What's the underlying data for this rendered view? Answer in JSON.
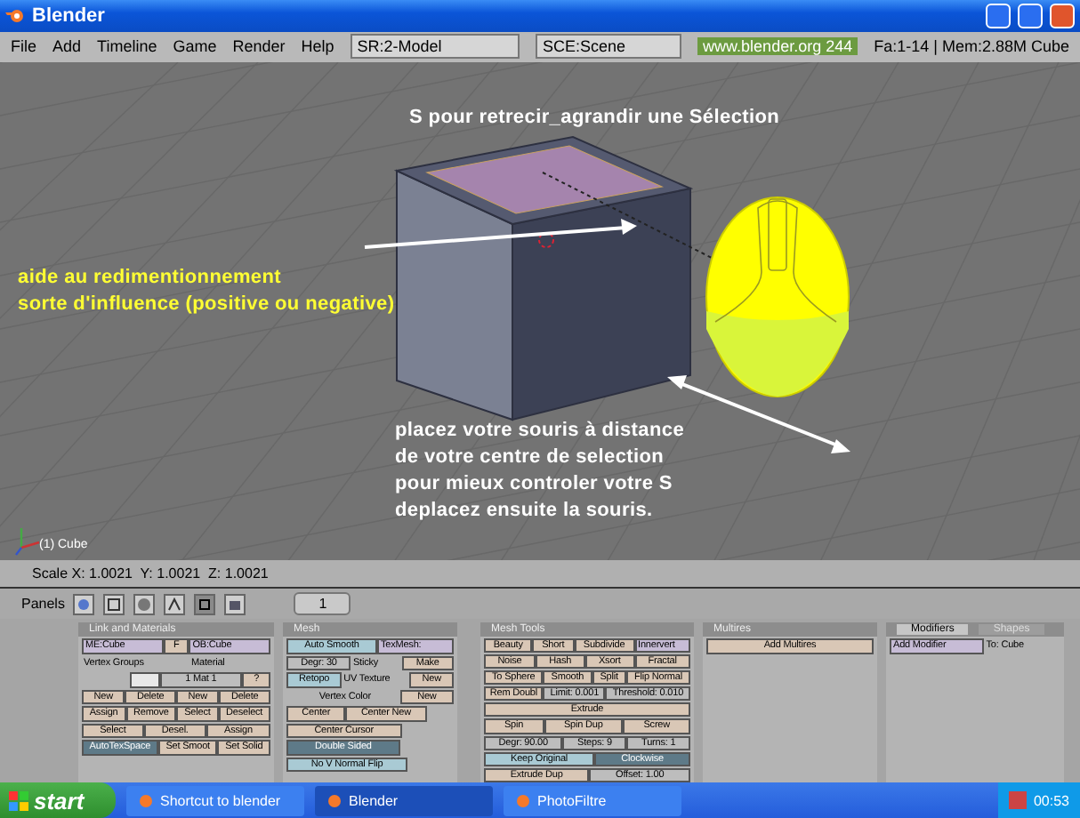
{
  "window": {
    "title": "Blender"
  },
  "menu": {
    "items": [
      "File",
      "Add",
      "Timeline",
      "Game",
      "Render",
      "Help"
    ],
    "screen": "SR:2-Model",
    "scene": "SCE:Scene",
    "url": "www.blender.org 244",
    "stats": "Fa:1-14 | Mem:2.88M Cube"
  },
  "viewport": {
    "object_label": "(1) Cube",
    "annotations": [
      {
        "color": "#ffffff",
        "lines": [
          "S pour retrecir_agrandir une Sélection"
        ]
      },
      {
        "color": "#ffff33",
        "lines": [
          "aide au redimentionnement",
          "sorte d'influence (positive ou negative)"
        ]
      },
      {
        "color": "#ffffff",
        "lines": [
          "placez votre souris à distance",
          "de votre centre de selection",
          "pour mieux controler votre S",
          "deplacez ensuite la souris."
        ]
      }
    ]
  },
  "status": "Scale X: 1.0021  Y: 1.0021  Z: 1.0021",
  "buttons_header": {
    "label": "Panels",
    "frame": "1",
    "context_tabs": [
      {
        "kind": "logic",
        "selected": false
      },
      {
        "kind": "script",
        "selected": false
      },
      {
        "kind": "shading",
        "selected": false
      },
      {
        "kind": "object",
        "selected": false
      },
      {
        "kind": "editing",
        "selected": true
      },
      {
        "kind": "scene",
        "selected": false
      }
    ]
  },
  "panels": [
    {
      "title": "Link and Materials",
      "rows": [
        [
          {
            "kind": "field",
            "text": "ME:Cube"
          },
          {
            "kind": "button",
            "text": "F"
          },
          {
            "kind": "field",
            "text": "OB:Cube"
          }
        ],
        [
          {
            "kind": "label",
            "text": "Vertex Groups"
          },
          {
            "kind": "label",
            "text": "Material"
          }
        ],
        [
          {
            "kind": "space"
          },
          {
            "kind": "swatch"
          },
          {
            "kind": "number",
            "text": "1 Mat 1"
          },
          {
            "kind": "button",
            "text": "?"
          }
        ],
        [
          {
            "kind": "button",
            "text": "New"
          },
          {
            "kind": "button",
            "text": "Delete"
          },
          {
            "kind": "button",
            "text": "New"
          },
          {
            "kind": "button",
            "text": "Delete"
          }
        ],
        [
          {
            "kind": "button",
            "text": "Assign"
          },
          {
            "kind": "button",
            "text": "Remove"
          },
          {
            "kind": "button",
            "text": "Select"
          },
          {
            "kind": "button",
            "text": "Deselect"
          }
        ],
        [
          {
            "kind": "button",
            "text": "Select"
          },
          {
            "kind": "button",
            "text": "Desel."
          },
          {
            "kind": "button",
            "text": "Assign"
          }
        ],
        [
          {
            "kind": "toggle",
            "text": "AutoTexSpace",
            "on": true
          },
          {
            "kind": "button",
            "text": "Set Smoot"
          },
          {
            "kind": "button",
            "text": "Set Solid"
          }
        ]
      ]
    },
    {
      "title": "Mesh",
      "rows": [
        [
          {
            "kind": "toggle",
            "text": "Auto Smooth",
            "on": false
          },
          {
            "kind": "field",
            "text": "TexMesh:"
          }
        ],
        [
          {
            "kind": "number",
            "text": "Degr: 30"
          },
          {
            "kind": "label",
            "text": "Sticky"
          },
          {
            "kind": "button",
            "text": "Make"
          }
        ],
        [
          {
            "kind": "toggle",
            "text": "Retopo",
            "on": false
          },
          {
            "kind": "label",
            "text": "UV Texture"
          },
          {
            "kind": "button",
            "text": "New"
          }
        ],
        [
          {
            "kind": "space"
          },
          {
            "kind": "label",
            "text": "Vertex Color"
          },
          {
            "kind": "button",
            "text": "New"
          }
        ],
        [
          {
            "kind": "button",
            "text": "Center"
          },
          {
            "kind": "button",
            "text": "Center New"
          },
          {
            "kind": "space"
          }
        ],
        [
          {
            "kind": "button",
            "text": "Center Cursor"
          },
          {
            "kind": "space"
          }
        ],
        [
          {
            "kind": "toggle",
            "text": "Double Sided",
            "on": true
          },
          {
            "kind": "space"
          }
        ],
        [
          {
            "kind": "toggle",
            "text": "No V Normal Flip",
            "on": false
          },
          {
            "kind": "space"
          }
        ]
      ]
    },
    {
      "title": "Mesh Tools",
      "rows": [
        [
          {
            "kind": "button",
            "text": "Beauty"
          },
          {
            "kind": "button",
            "text": "Short"
          },
          {
            "kind": "button",
            "text": "Subdivide"
          },
          {
            "kind": "field",
            "text": "Innervert"
          }
        ],
        [
          {
            "kind": "button",
            "text": "Noise"
          },
          {
            "kind": "button",
            "text": "Hash"
          },
          {
            "kind": "button",
            "text": "Xsort"
          },
          {
            "kind": "button",
            "text": "Fractal"
          }
        ],
        [
          {
            "kind": "button",
            "text": "To Sphere"
          },
          {
            "kind": "button",
            "text": "Smooth"
          },
          {
            "kind": "button",
            "text": "Split"
          },
          {
            "kind": "button",
            "text": "Flip Normal"
          }
        ],
        [
          {
            "kind": "button",
            "text": "Rem Doubl"
          },
          {
            "kind": "number",
            "text": "Limit: 0.001"
          },
          {
            "kind": "number",
            "text": "Threshold: 0.010"
          }
        ],
        [
          {
            "kind": "button",
            "text": "Extrude"
          }
        ],
        [
          {
            "kind": "button",
            "text": "Spin"
          },
          {
            "kind": "button",
            "text": "Spin Dup"
          },
          {
            "kind": "button",
            "text": "Screw"
          }
        ],
        [
          {
            "kind": "number",
            "text": "Degr: 90.00"
          },
          {
            "kind": "number",
            "text": "Steps: 9"
          },
          {
            "kind": "number",
            "text": "Turns: 1"
          }
        ],
        [
          {
            "kind": "toggle",
            "text": "Keep Original",
            "on": false
          },
          {
            "kind": "toggle",
            "text": "Clockwise",
            "on": true
          }
        ],
        [
          {
            "kind": "button",
            "text": "Extrude Dup"
          },
          {
            "kind": "number",
            "text": "Offset: 1.00"
          }
        ]
      ]
    },
    {
      "title": "Multires",
      "rows": [
        [
          {
            "kind": "button",
            "text": "Add Multires"
          }
        ]
      ]
    },
    {
      "tabs": [
        {
          "label": "Modifiers",
          "selected": true
        },
        {
          "label": "Shapes",
          "selected": false
        }
      ],
      "rows": [
        [
          {
            "kind": "field",
            "text": "Add Modifier"
          },
          {
            "kind": "label",
            "text": "To: Cube"
          }
        ]
      ]
    }
  ],
  "taskbar": {
    "start": "start",
    "tasks": [
      {
        "label": "Shortcut to blender",
        "selected": false
      },
      {
        "label": "Blender",
        "selected": true
      },
      {
        "label": "PhotoFiltre",
        "selected": false
      }
    ],
    "clock": "00:53"
  }
}
